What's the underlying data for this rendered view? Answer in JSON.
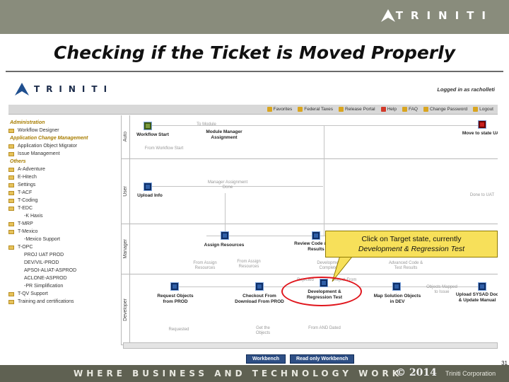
{
  "header": {
    "logo_text": "TRINITI"
  },
  "slide": {
    "title": "Checking if the Ticket is Moved Properly",
    "page_number": "31"
  },
  "app": {
    "logo_text": "TRINITI",
    "logged_in": "Logged in as racholleti",
    "toolbar": [
      "Favorites",
      "Federal Taxes",
      "Release Portal",
      "Help",
      "FAQ",
      "Change Password",
      "Logout"
    ],
    "sidebar": {
      "items": [
        {
          "kind": "heading",
          "label": "Administration"
        },
        {
          "kind": "item",
          "label": "Workflow Designer"
        },
        {
          "kind": "heading",
          "label": "Application Change Management"
        },
        {
          "kind": "item",
          "label": "Application Object Migrator"
        },
        {
          "kind": "item",
          "label": "Issue Management"
        },
        {
          "kind": "heading",
          "label": "Others"
        },
        {
          "kind": "item",
          "label": "A-Adventure"
        },
        {
          "kind": "item",
          "label": "E-Hitech"
        },
        {
          "kind": "item",
          "label": "Settings"
        },
        {
          "kind": "item",
          "label": "T-ACF"
        },
        {
          "kind": "item",
          "label": "T-Coding"
        },
        {
          "kind": "item",
          "label": "T-EDC"
        },
        {
          "kind": "sub",
          "label": "-K Haxis"
        },
        {
          "kind": "item",
          "label": "T-MRP"
        },
        {
          "kind": "item",
          "label": "T-Mexico"
        },
        {
          "kind": "sub",
          "label": "-Mexico Support"
        },
        {
          "kind": "item",
          "label": "T-OPC"
        },
        {
          "kind": "node",
          "label": "PROJ UAT PROD"
        },
        {
          "kind": "node",
          "label": "DEV/VIL-PROD"
        },
        {
          "kind": "node",
          "label": "APSOI-ALIAT-ASPROD"
        },
        {
          "kind": "node",
          "label": "ACLONE-ASPROD"
        },
        {
          "kind": "sub",
          "label": "-PR Simplification"
        },
        {
          "kind": "item",
          "label": "T-QV Support"
        },
        {
          "kind": "item",
          "label": "Training and certifications"
        }
      ]
    },
    "lanes": [
      "Auto",
      "User",
      "Manager",
      "Developer"
    ],
    "workflow": {
      "workflow_start": "Workflow Start",
      "from_workflow_start": "From Workflow Start",
      "to_module": "To Module",
      "module_assignment": "Module Manager Assignment",
      "upload_info": "Upload Info",
      "manager_assignment_done": "Manager Assignment Done",
      "move_to_uat": "Move to state UAT",
      "done": "Done to UAT",
      "assign_resources": "Assign Resources",
      "review_code": "Review Code & Test Results",
      "development_completed": "Development Completed",
      "from_assign_resources": "From Assign Resources",
      "from_assign": "From Assign Resources",
      "advanced": "Advanced Code & Test Results",
      "request_objects": "Request Objects from PROD",
      "checkout": "Checkout From Download From PROD",
      "development": "Development & Regression Test",
      "map_solution": "Map Solution Objects in DEV",
      "upload_sysad": "Upload SYSAD Doc & Update Manual",
      "objects_mapped": "Objects Mapped to Issue",
      "requested": "Requested",
      "rejected": "Rejected",
      "reject_from": "Reject From",
      "get_the": "Get the Objects",
      "from_and_dated": "From AND Dated"
    },
    "buttons": {
      "workbench": "Workbench",
      "read_only": "Read only Workbench"
    }
  },
  "callout": {
    "line1": "Click on Target state, currently",
    "line2": "Development & Regression Test"
  },
  "footer": {
    "slogan": "WHERE BUSINESS AND TECHNOLOGY WORK",
    "copyright_symbol": "©",
    "year": "2014",
    "corp": "Triniti Corporation"
  },
  "colors": {
    "band": "#898c7c",
    "footer_band": "#5f6152",
    "callout": "#f7e05a",
    "highlight": "#e0161d",
    "node": "#2f5fa8",
    "button": "#2e4f85"
  }
}
